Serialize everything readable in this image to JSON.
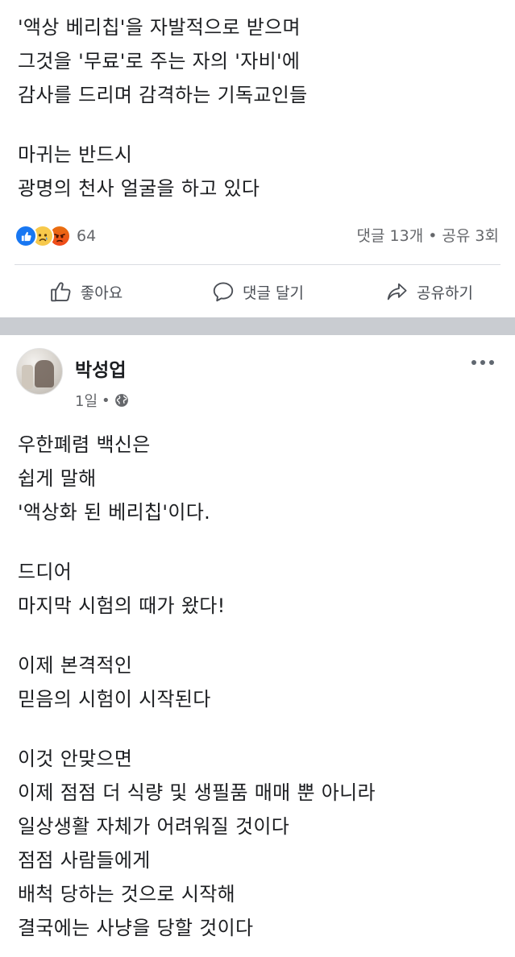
{
  "post_top": {
    "lines": [
      "'액상 베리칩'을 자발적으로 받으며",
      "그것을 '무료'로 주는 자의 '자비'에",
      "감사를 드리며 감격하는 기독교인들",
      "",
      "마귀는 반드시",
      "광명의 천사 얼굴을 하고 있다"
    ],
    "reaction_icons": [
      "like-icon",
      "sad-icon",
      "angry-icon"
    ],
    "reaction_count": "64",
    "comments": "댓글 13개",
    "dot": "•",
    "shares": "공유 3회",
    "actions": {
      "like": "좋아요",
      "comment": "댓글 달기",
      "share": "공유하기"
    }
  },
  "post_bottom": {
    "author": "박성업",
    "time": "1일",
    "dot": "•",
    "privacy_icon": "globe-icon",
    "lines": [
      "우한폐렴 백신은",
      "쉽게 말해",
      "'액상화 된 베리칩'이다.",
      "",
      "드디어",
      "마지막 시험의 때가 왔다!",
      "",
      "이제 본격적인",
      "믿음의 시험이 시작된다",
      "",
      "이것 안맞으면",
      "이제 점점 더 식량 및 생필품 매매 뿐 아니라",
      "일상생활 자체가 어려워질 것이다",
      "점점 사람들에게",
      "배척 당하는 것으로 시작해",
      "결국에는 사냥을 당할 것이다"
    ]
  },
  "colors": {
    "text": "#1c1e21",
    "secondary": "#65676b",
    "like_blue": "#1877f2",
    "separator": "#c9ccd1"
  }
}
